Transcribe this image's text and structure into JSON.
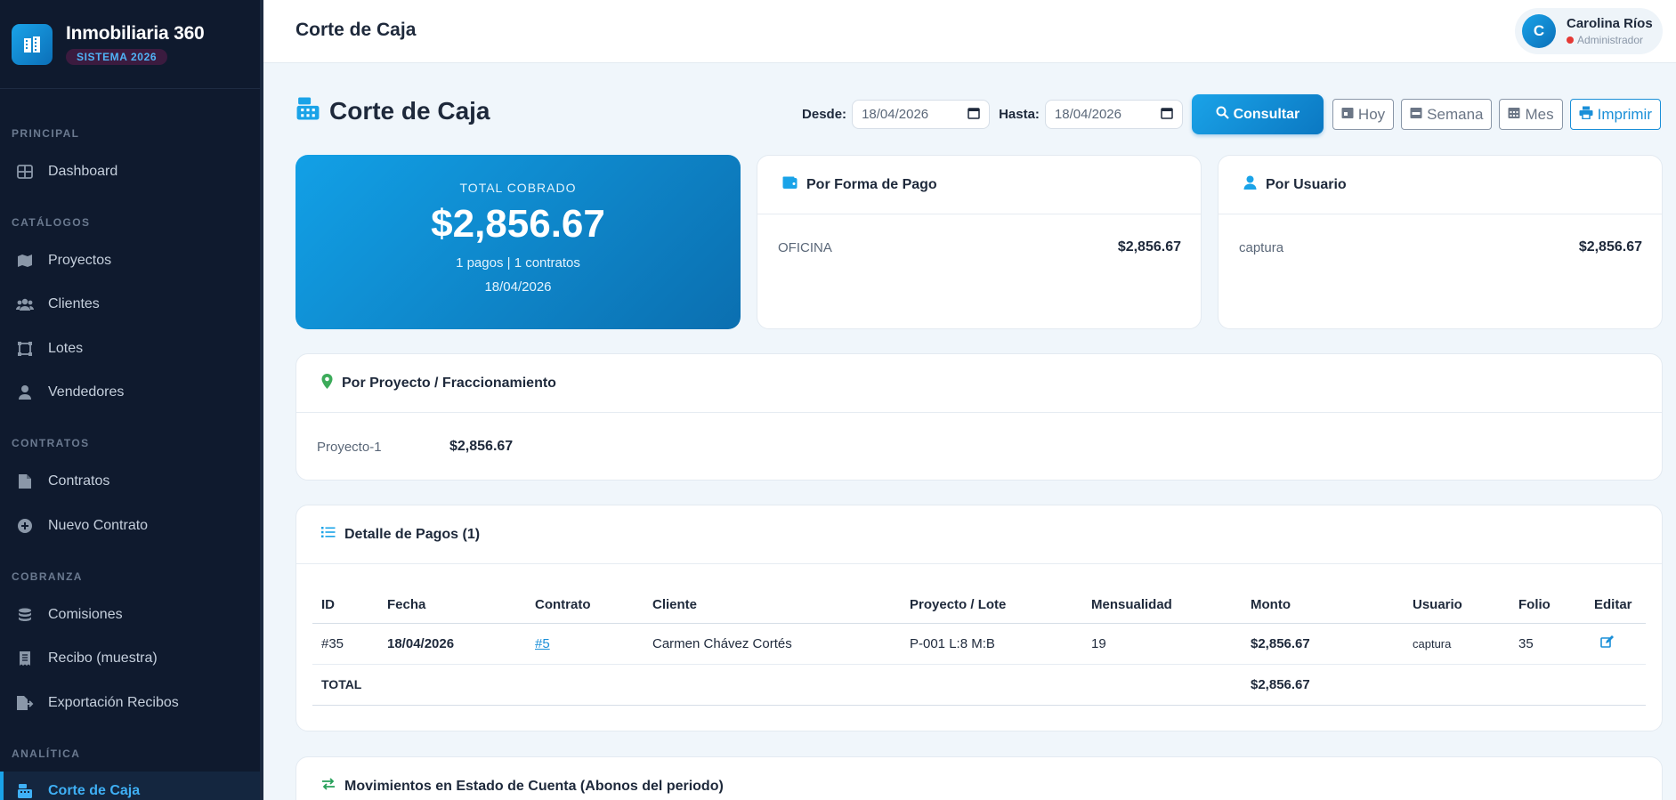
{
  "app": {
    "name": "Inmobiliaria 360",
    "badge": "SISTEMA 2026"
  },
  "sidebar": {
    "sections": [
      {
        "title": "PRINCIPAL"
      },
      {
        "title": "CATÁLOGOS"
      },
      {
        "title": "CONTRATOS"
      },
      {
        "title": "COBRANZA"
      },
      {
        "title": "ANALÍTICA"
      }
    ],
    "items": [
      {
        "label": "Dashboard",
        "icon": "dashboard-icon"
      },
      {
        "label": "Proyectos",
        "icon": "map-icon"
      },
      {
        "label": "Clientes",
        "icon": "users-icon"
      },
      {
        "label": "Lotes",
        "icon": "vector-square-icon"
      },
      {
        "label": "Vendedores",
        "icon": "user-tie-icon"
      },
      {
        "label": "Contratos",
        "icon": "file-contract-icon"
      },
      {
        "label": "Nuevo Contrato",
        "icon": "plus-circle-icon"
      },
      {
        "label": "Comisiones",
        "icon": "coins-icon"
      },
      {
        "label": "Recibo (muestra)",
        "icon": "receipt-icon"
      },
      {
        "label": "Exportación Recibos",
        "icon": "file-export-icon"
      },
      {
        "label": "Corte de Caja",
        "icon": "cash-register-icon",
        "active": true
      }
    ]
  },
  "topbar": {
    "title": "Corte de Caja",
    "user": {
      "initial": "C",
      "name": "Carolina Ríos",
      "role": "Administrador"
    }
  },
  "page": {
    "title": "Corte de Caja",
    "filters": {
      "desde_label": "Desde:",
      "desde_value": "18/04/2026",
      "hasta_label": "Hasta:",
      "hasta_value": "18/04/2026",
      "consultar": "Consultar",
      "hoy": "Hoy",
      "semana": "Semana",
      "mes": "Mes",
      "imprimir": "Imprimir"
    }
  },
  "total_card": {
    "label": "TOTAL COBRADO",
    "amount": "$2,856.67",
    "summary": "1 pagos | 1 contratos",
    "date": "18/04/2026"
  },
  "por_forma_pago": {
    "title": "Por Forma de Pago",
    "rows": [
      {
        "key": "OFICINA",
        "value": "$2,856.67"
      }
    ]
  },
  "por_usuario": {
    "title": "Por Usuario",
    "rows": [
      {
        "key": "captura",
        "value": "$2,856.67"
      }
    ]
  },
  "por_proyecto": {
    "title": "Por Proyecto / Fraccionamiento",
    "rows": [
      {
        "key": "Proyecto-1",
        "value": "$2,856.67"
      }
    ]
  },
  "detalle": {
    "title": "Detalle de Pagos (1)",
    "columns": [
      "ID",
      "Fecha",
      "Contrato",
      "Cliente",
      "Proyecto / Lote",
      "Mensualidad",
      "Monto",
      "Usuario",
      "Folio",
      "Editar"
    ],
    "rows": [
      {
        "id": "#35",
        "fecha": "18/04/2026",
        "contrato": "#5",
        "cliente": "Carmen Chávez Cortés",
        "proyecto_lote": "P-001 L:8 M:B",
        "mensualidad": "19",
        "monto": "$2,856.67",
        "usuario": "captura",
        "folio": "35"
      }
    ],
    "total_label": "TOTAL",
    "total_value": "$2,856.67"
  },
  "movimientos": {
    "title": "Movimientos en Estado de Cuenta (Abonos del periodo)"
  },
  "colors": {
    "accent": "#1aa3e8",
    "sidebar_bg": "#0f1a2e",
    "success": "#27a05a"
  }
}
